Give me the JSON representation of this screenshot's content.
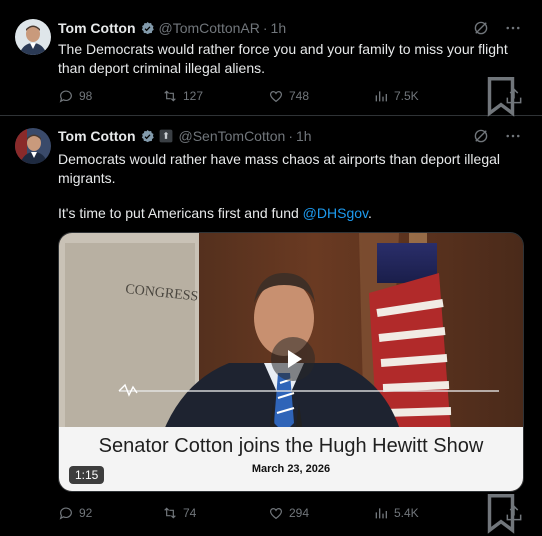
{
  "tweets": [
    {
      "name": "Tom Cotton",
      "handle": "@TomCottonAR",
      "time": "1h",
      "text": "The Democrats would rather force you and your family to miss your flight than deport criminal illegal aliens.",
      "replies": "98",
      "reposts": "127",
      "likes": "748",
      "views": "7.5K"
    },
    {
      "name": "Tom Cotton",
      "handle": "@SenTomCotton",
      "time": "1h",
      "text_p1": "Democrats would rather have mass chaos at airports than deport illegal migrants.",
      "text_p2_prefix": "It's time to put Americans first and fund ",
      "text_p2_link": "@DHSgov",
      "text_p2_suffix": ".",
      "media": {
        "image_text": "CONGRESS",
        "caption_title": "Senator Cotton joins the Hugh Hewitt Show",
        "caption_date": "March 23, 2026",
        "duration": "1:15"
      },
      "replies": "92",
      "reposts": "74",
      "likes": "294",
      "views": "5.4K"
    }
  ],
  "colors": {
    "background": "#000000",
    "text": "#e7e9ea",
    "muted": "#71767b",
    "link": "#1d9bf0",
    "verified": "#829aab"
  },
  "icons": [
    "grok-icon",
    "more-icon",
    "reply-icon",
    "repost-icon",
    "like-icon",
    "views-icon",
    "bookmark-icon",
    "share-icon",
    "verified-icon",
    "official-badge-icon",
    "play-icon"
  ]
}
